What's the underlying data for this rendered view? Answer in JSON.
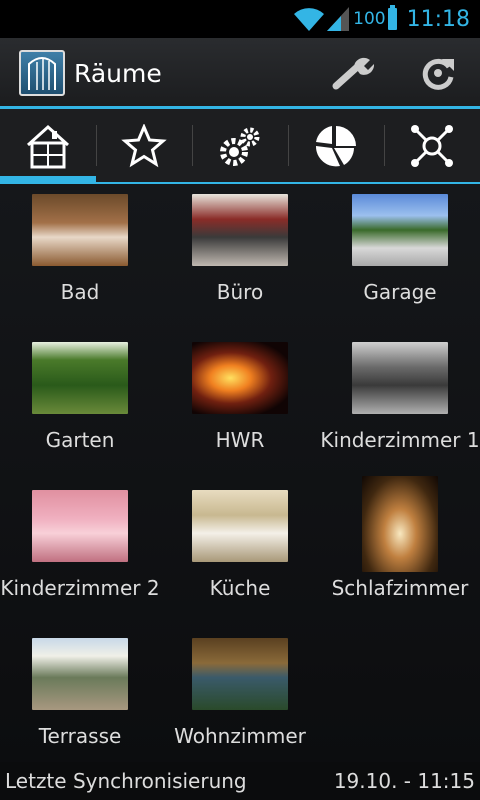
{
  "status_bar": {
    "battery": "100",
    "time": "11:18"
  },
  "action_bar": {
    "title": "Räume",
    "actions": [
      "wrench-icon",
      "refresh-icon"
    ]
  },
  "tabs": [
    {
      "icon": "house-icon",
      "active": true
    },
    {
      "icon": "star-icon",
      "active": false
    },
    {
      "icon": "gears-icon",
      "active": false
    },
    {
      "icon": "pie-chart-icon",
      "active": false
    },
    {
      "icon": "network-icon",
      "active": false
    }
  ],
  "rooms": [
    {
      "label": "Bad"
    },
    {
      "label": "Büro"
    },
    {
      "label": "Garage"
    },
    {
      "label": "Garten"
    },
    {
      "label": "HWR"
    },
    {
      "label": "Kinderzimmer 1"
    },
    {
      "label": "Kinderzimmer 2"
    },
    {
      "label": "Küche"
    },
    {
      "label": "Schlafzimmer"
    },
    {
      "label": "Terrasse"
    },
    {
      "label": "Wohnzimmer"
    }
  ],
  "footer": {
    "sync_label": "Letzte Synchronisierung",
    "sync_time": "19.10. - 11:15"
  },
  "colors": {
    "accent": "#33b5e5"
  }
}
